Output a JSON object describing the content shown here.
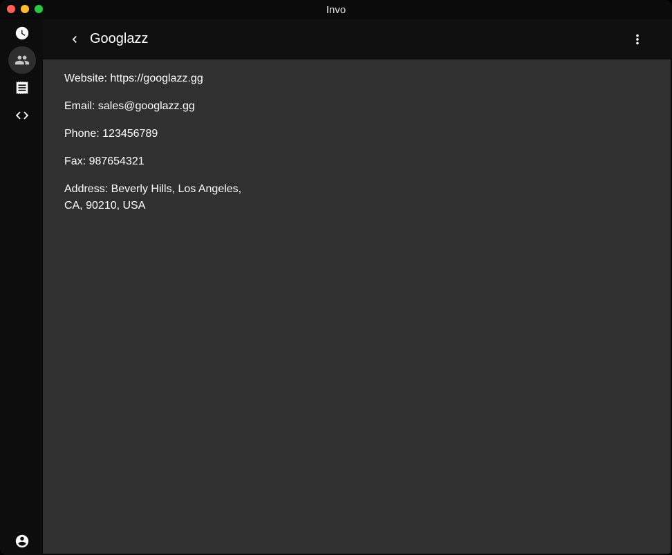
{
  "window": {
    "title": "Invo"
  },
  "sidebar": {
    "items": [
      {
        "icon": "clock-icon",
        "active": false
      },
      {
        "icon": "people-icon",
        "active": true
      },
      {
        "icon": "receipt-icon",
        "active": false
      },
      {
        "icon": "code-icon",
        "active": false
      }
    ],
    "bottom_icon": "account-circle-icon"
  },
  "appbar": {
    "title": "Googlazz"
  },
  "details": {
    "website": "Website: https://googlazz.gg",
    "email": "Email: sales@googlazz.gg",
    "phone": "Phone: 123456789",
    "fax": "Fax: 987654321",
    "address": "Address: Beverly Hills, Los Angeles, CA, 90210, USA"
  }
}
